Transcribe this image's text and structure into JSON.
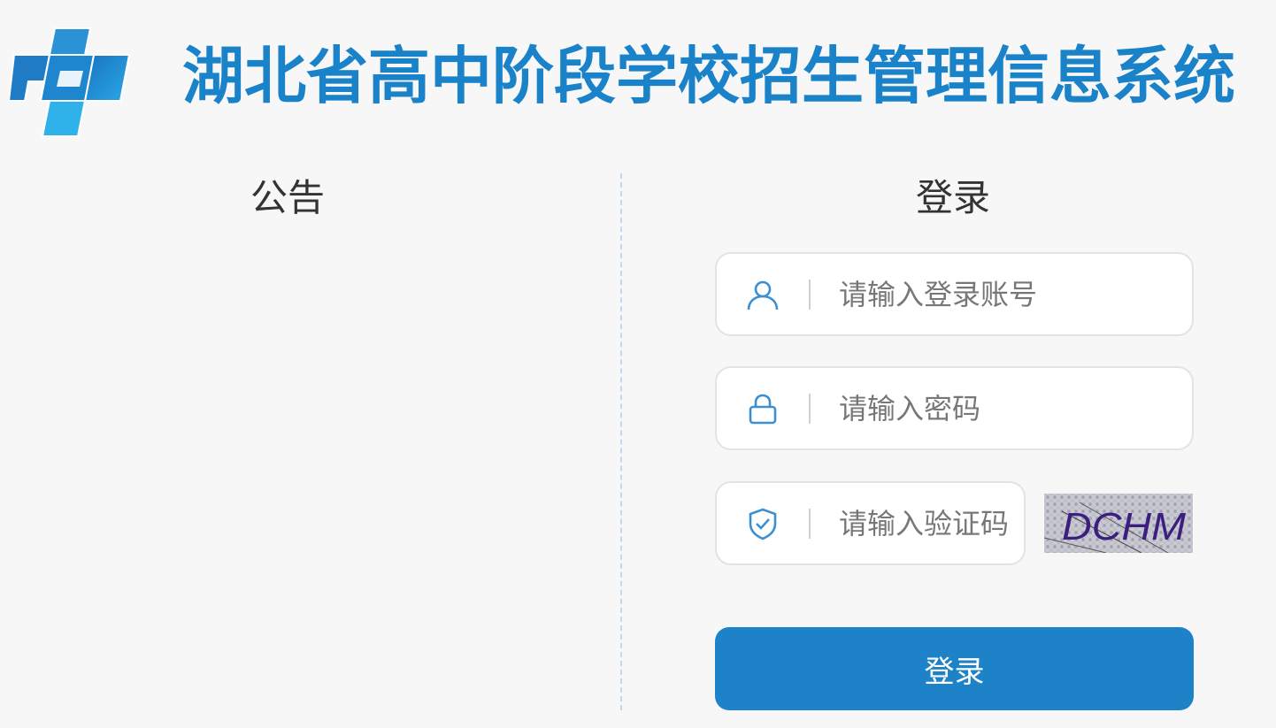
{
  "header": {
    "title": "湖北省高中阶段学校招生管理信息系统"
  },
  "notice": {
    "heading": "公告"
  },
  "login": {
    "heading": "登录",
    "username_placeholder": "请输入登录账号",
    "password_placeholder": "请输入密码",
    "captcha_placeholder": "请输入验证码",
    "captcha_text": "DCHM",
    "submit_label": "登录"
  },
  "icons": {
    "logo": "logo-icon",
    "username": "user-icon",
    "password": "lock-icon",
    "captcha": "shield-check-icon"
  },
  "colors": {
    "brand": "#1a82c9",
    "button": "#1e82c8",
    "icon": "#3d8fd0",
    "background": "#f7f7f7"
  }
}
